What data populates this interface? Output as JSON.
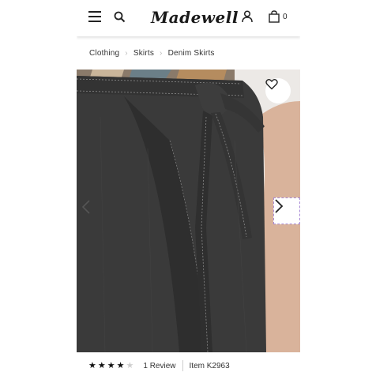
{
  "header": {
    "brand": "Madewell",
    "menu_icon": "hamburger-menu-icon",
    "search_icon": "search-icon",
    "account_icon": "user-icon",
    "bag_icon": "shopping-bag-icon",
    "bag_count": "0"
  },
  "breadcrumb": {
    "items": [
      "Clothing",
      "Skirts",
      "Denim Skirts"
    ]
  },
  "product": {
    "wishlist_icon": "heart-icon",
    "prev_icon": "chevron-left-icon",
    "next_icon": "chevron-right-icon",
    "rating": 4,
    "rating_max": 5,
    "review_text": "1 Review",
    "item_text": "Item K2963"
  },
  "colors": {
    "denim": "#3a3a3a",
    "skin": "#d9b39b",
    "background": "#ece9e6",
    "accent_dashed": "#a98bd6"
  }
}
